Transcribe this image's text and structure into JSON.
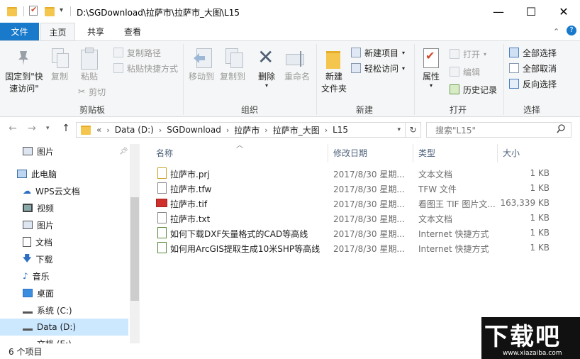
{
  "window": {
    "title": "D:\\SGDownload\\拉萨市\\拉萨市_大图\\L15",
    "minimize": "—",
    "maximize": "☐",
    "close": "✕"
  },
  "ribbon": {
    "tabs": {
      "file": "文件",
      "home": "主页",
      "share": "共享",
      "view": "查看"
    },
    "clipboard": {
      "label": "剪贴板",
      "pin": "固定到\"快",
      "pin2": "速访问\"",
      "copy": "复制",
      "paste": "粘贴",
      "copy_path": "复制路径",
      "paste_shortcut": "粘贴快捷方式",
      "cut": "剪切"
    },
    "organize": {
      "label": "组织",
      "move_to": "移动到",
      "copy_to": "复制到",
      "delete": "删除",
      "rename": "重命名"
    },
    "new": {
      "label": "新建",
      "new_folder": "新建",
      "new_folder2": "文件夹",
      "new_item": "新建项目",
      "easy_access": "轻松访问"
    },
    "open": {
      "label": "打开",
      "properties": "属性",
      "open": "打开",
      "edit": "编辑",
      "history": "历史记录"
    },
    "select": {
      "label": "选择",
      "select_all": "全部选择",
      "select_none": "全部取消",
      "invert": "反向选择"
    }
  },
  "address": {
    "crumbs": [
      "Data (D:)",
      "SGDownload",
      "拉萨市",
      "拉萨市_大图",
      "L15"
    ],
    "overflow": "«",
    "search_placeholder": "搜索\"L15\""
  },
  "nav_pane": {
    "items": [
      {
        "label": "图片",
        "icon": "pictures-icon"
      },
      {
        "label": "此电脑",
        "icon": "computer-icon"
      },
      {
        "label": "WPS云文档",
        "icon": "cloud-icon"
      },
      {
        "label": "视频",
        "icon": "video-icon"
      },
      {
        "label": "图片",
        "icon": "pictures-icon"
      },
      {
        "label": "文档",
        "icon": "documents-icon"
      },
      {
        "label": "下载",
        "icon": "download-icon"
      },
      {
        "label": "音乐",
        "icon": "music-icon"
      },
      {
        "label": "桌面",
        "icon": "desktop-icon"
      },
      {
        "label": "系统 (C:)",
        "icon": "drive-icon"
      },
      {
        "label": "Data (D:)",
        "icon": "drive-icon"
      },
      {
        "label": "文档 (E:)",
        "icon": "drive-icon"
      }
    ]
  },
  "file_list": {
    "columns": {
      "name": "名称",
      "date": "修改日期",
      "type": "类型",
      "size": "大小"
    },
    "rows": [
      {
        "name": "拉萨市.prj",
        "date": "2017/8/30 星期...",
        "type": "文本文档",
        "size": "1 KB",
        "icon": "text-file-icon"
      },
      {
        "name": "拉萨市.tfw",
        "date": "2017/8/30 星期...",
        "type": "TFW 文件",
        "size": "1 KB",
        "icon": "blank-file-icon"
      },
      {
        "name": "拉萨市.tif",
        "date": "2017/8/30 星期...",
        "type": "看图王 TIF 图片文...",
        "size": "163,339 KB",
        "icon": "tif-image-icon"
      },
      {
        "name": "拉萨市.txt",
        "date": "2017/8/30 星期...",
        "type": "文本文档",
        "size": "1 KB",
        "icon": "text-file-icon"
      },
      {
        "name": "如何下载DXF矢量格式的CAD等高线",
        "date": "2017/8/30 星期...",
        "type": "Internet 快捷方式",
        "size": "1 KB",
        "icon": "internet-shortcut-icon"
      },
      {
        "name": "如何用ArcGIS提取生成10米SHP等高线",
        "date": "2017/8/30 星期...",
        "type": "Internet 快捷方式",
        "size": "1 KB",
        "icon": "internet-shortcut-icon"
      }
    ]
  },
  "status": {
    "count": "6 个项目"
  },
  "watermark": {
    "brand": "下载吧",
    "url": "www.xiazaiba.com"
  },
  "colors": {
    "accent": "#1979ca",
    "folder": "#f4c64e"
  }
}
